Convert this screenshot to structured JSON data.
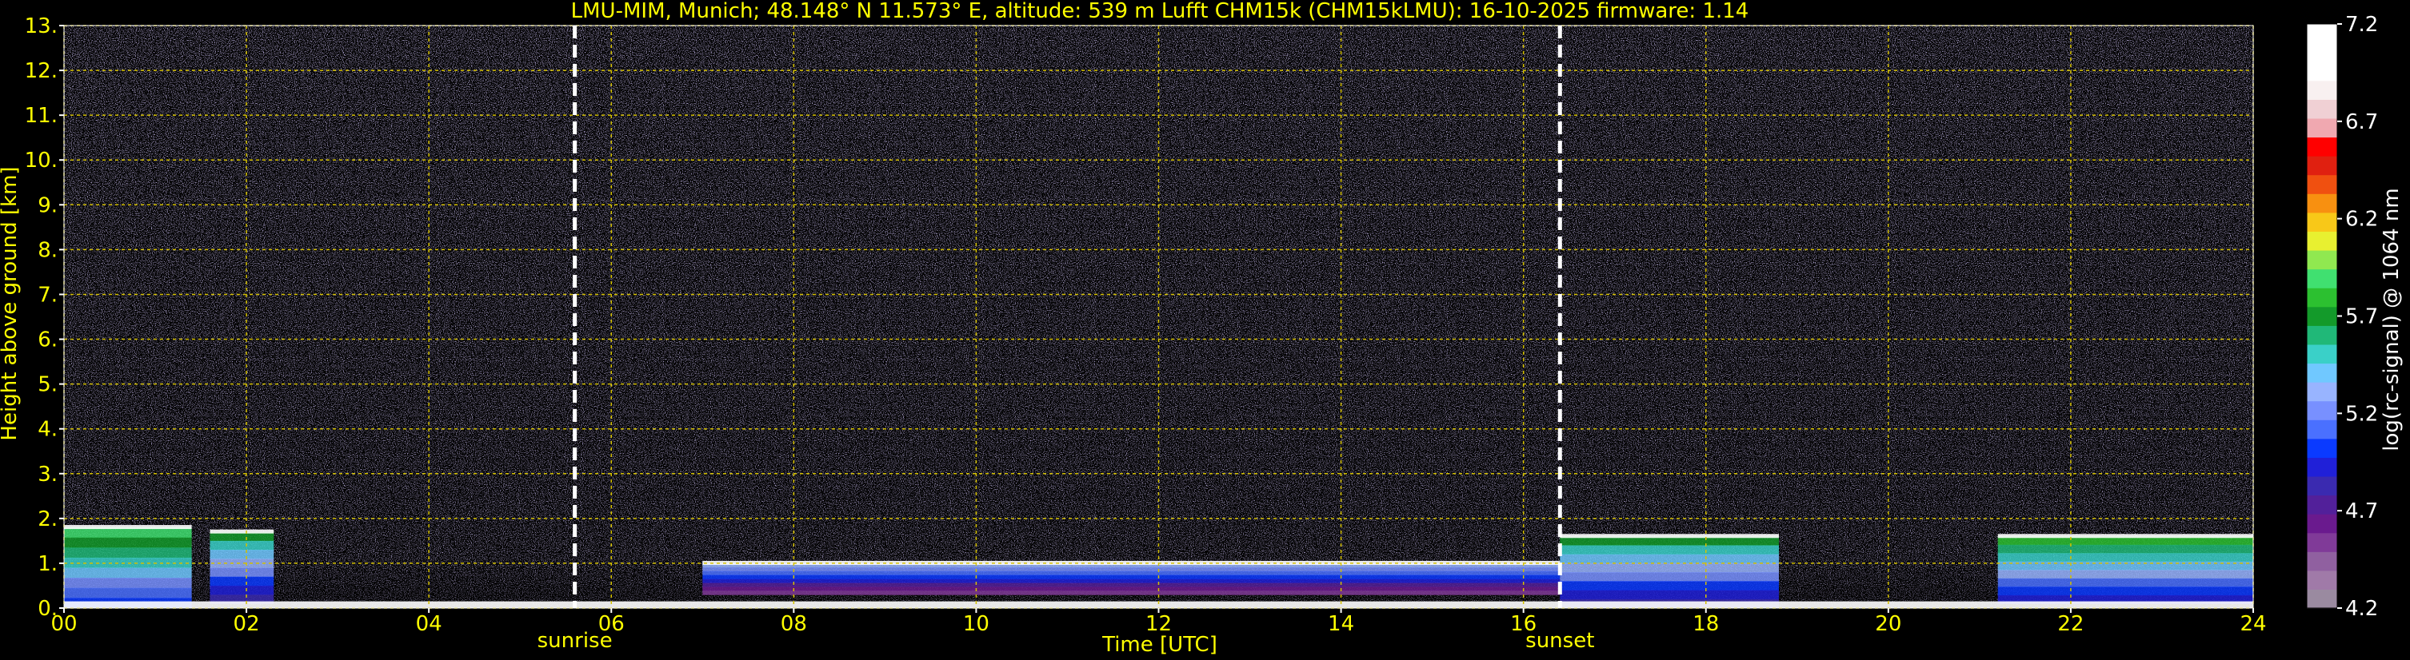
{
  "chart_data": {
    "type": "heatmap",
    "title": "LMU-MIM, Munich; 48.148° N 11.573° E, altitude: 539 m    Lufft CHM15k (CHM15kLMU): 16-10-2025    firmware: 1.14",
    "xlabel": "Time [UTC]",
    "ylabel": "Height above ground [km]",
    "xlim": [
      0,
      24
    ],
    "ylim": [
      0,
      13
    ],
    "x_ticks": [
      "00",
      "02",
      "04",
      "06",
      "08",
      "10",
      "12",
      "14",
      "16",
      "18",
      "20",
      "22",
      "24"
    ],
    "y_ticks": [
      "0.",
      "1.",
      "2.",
      "3.",
      "4.",
      "5.",
      "6.",
      "7.",
      "8.",
      "9.",
      "10.",
      "11.",
      "12.",
      "13."
    ],
    "grid": true,
    "markers": [
      {
        "label": "sunrise",
        "x": 5.6
      },
      {
        "label": "sunset",
        "x": 16.4
      }
    ],
    "colorbar": {
      "label": "log(rc-signal) @ 1064 nm",
      "range": [
        4.2,
        7.2
      ],
      "ticks": [
        "4.2",
        "4.7",
        "5.2",
        "5.7",
        "6.2",
        "6.7",
        "7.2"
      ],
      "colors": [
        "#9a8aa0",
        "#a07aa8",
        "#9060a0",
        "#803a98",
        "#6a1a8e",
        "#52209a",
        "#3a2ab0",
        "#2020d8",
        "#0a3aff",
        "#4a70ff",
        "#7890ff",
        "#98b4ff",
        "#70c8ff",
        "#3ad0c8",
        "#20b878",
        "#139a2a",
        "#2cc030",
        "#40e070",
        "#90e850",
        "#e8f030",
        "#f8c818",
        "#f89010",
        "#f05010",
        "#e02010",
        "#ff0000",
        "#f0a8b0",
        "#f0d0d4",
        "#f8f0f0",
        "#ffffff",
        "#ffffff",
        "#ffffff"
      ]
    },
    "series": [
      {
        "x": [
          0.0,
          1.4
        ],
        "y": [
          0.0,
          1.8
        ],
        "level": 5.5
      },
      {
        "x": [
          1.6,
          2.3
        ],
        "y": [
          0.1,
          1.7
        ],
        "level": 5.3
      },
      {
        "x": [
          7.0,
          16.4
        ],
        "y": [
          0.3,
          1.0
        ],
        "level": 5.0
      },
      {
        "x": [
          16.4,
          18.8
        ],
        "y": [
          0.0,
          1.6
        ],
        "level": 5.3
      },
      {
        "x": [
          21.2,
          24.0
        ],
        "y": [
          0.1,
          1.6
        ],
        "level": 5.4
      }
    ],
    "noise_top_km": 13,
    "colors": {
      "text": "#ffff00",
      "grid": "#d4c000",
      "colorbar_text": "#ffffff",
      "background": "#000000"
    }
  }
}
